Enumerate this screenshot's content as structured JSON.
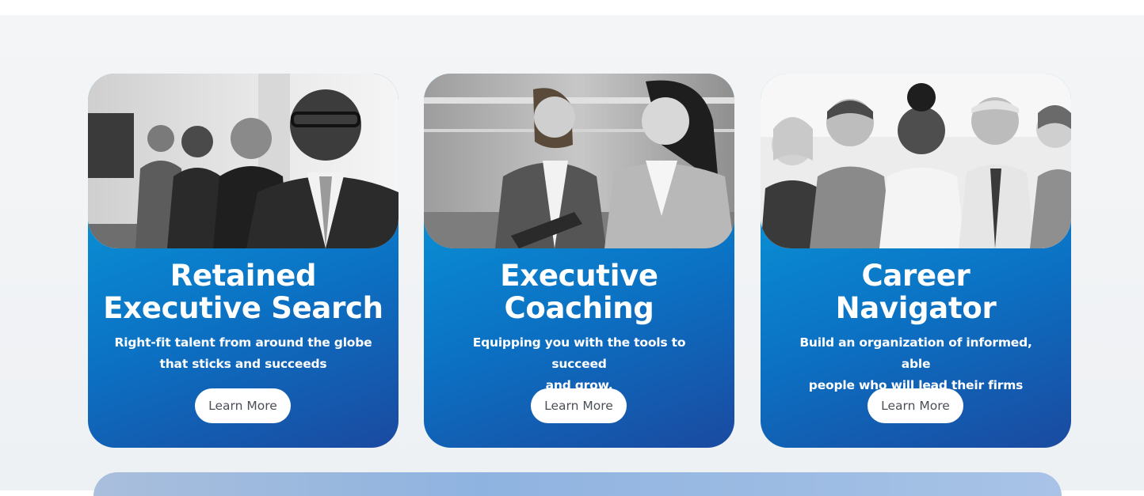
{
  "cards": [
    {
      "title_line1": "Retained",
      "title_line2": "Executive Search",
      "desc_line1": "Right-fit talent from around the globe",
      "desc_line2": "that sticks and succeeds",
      "button_label": "Learn More",
      "photo": "business-team-photo"
    },
    {
      "title_line1": "Executive",
      "title_line2": "Coaching",
      "desc_line1": "Equipping you with the tools to succeed",
      "desc_line2": "and grow.",
      "button_label": "Learn More",
      "photo": "coaching-conversation-photo"
    },
    {
      "title_line1": "Career",
      "title_line2": "Navigator",
      "desc_line1": "Build an organization of informed, able",
      "desc_line2": "people who will lead their firms",
      "button_label": "Learn More",
      "photo": "diverse-group-photo"
    }
  ],
  "colors": {
    "card_gradient_top": "#22b4ea",
    "card_gradient_bottom": "#1a4aa0",
    "button_bg": "#ffffff",
    "button_text": "#4a4f57",
    "section_bg": "#f4f5f6"
  }
}
